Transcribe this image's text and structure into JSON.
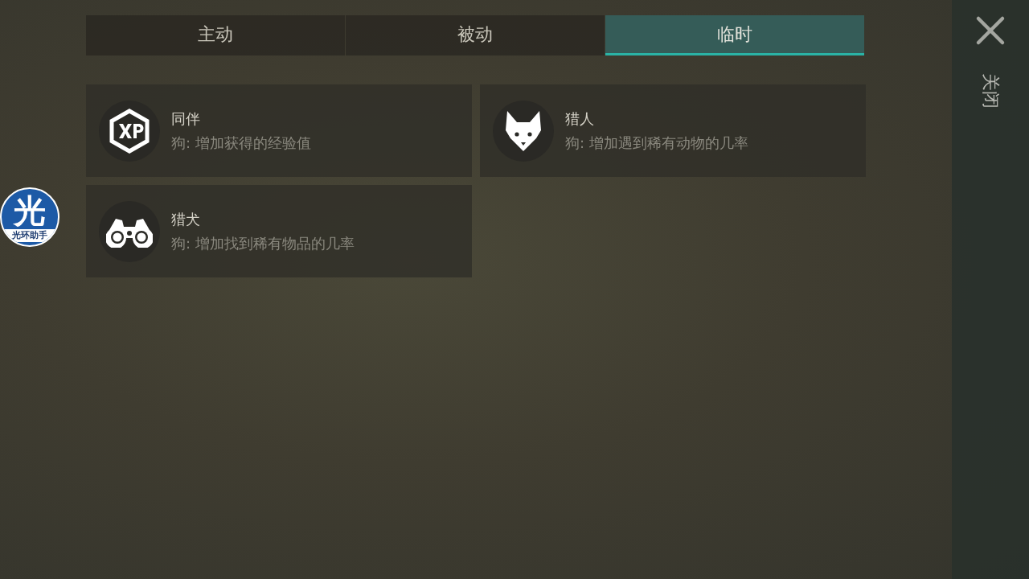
{
  "tabs": [
    {
      "label": "主动",
      "selected": false
    },
    {
      "label": "被动",
      "selected": false
    },
    {
      "label": "临时",
      "selected": true
    }
  ],
  "cards": [
    {
      "kind": "xp",
      "title": "同伴",
      "description": "狗: 增加获得的经验值"
    },
    {
      "kind": "fox",
      "title": "猎人",
      "description": "狗: 增加遇到稀有动物的几率"
    },
    {
      "kind": "binoculars",
      "title": "猎犬",
      "description": "狗: 增加找到稀有物品的几率"
    }
  ],
  "close_panel": {
    "label": "关闭"
  },
  "floating_badge": {
    "glyph": "光",
    "caption": "光环助手"
  }
}
